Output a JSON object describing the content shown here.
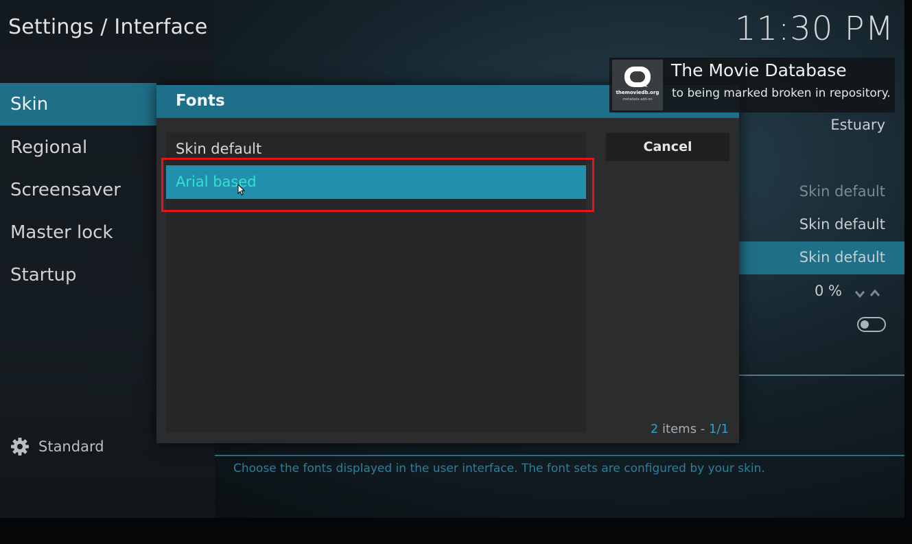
{
  "header": {
    "title": "Settings / Interface",
    "clock": "11:30 PM"
  },
  "sidebar": {
    "items": [
      {
        "label": "Skin"
      },
      {
        "label": "Regional"
      },
      {
        "label": "Screensaver"
      },
      {
        "label": "Master lock"
      },
      {
        "label": "Startup"
      }
    ],
    "active_index": 0,
    "settings_level": "Standard"
  },
  "background": {
    "values": {
      "skin": "Estuary",
      "value_1": "Skin default",
      "value_2": "Skin default",
      "value_3": "Skin default",
      "zoom": "0 %"
    },
    "description": "Choose the fonts displayed in the user interface. The font sets are configured by your skin."
  },
  "dialog": {
    "title": "Fonts",
    "items": [
      {
        "label": "Skin default"
      },
      {
        "label": "Arial based"
      }
    ],
    "selected_index": 1,
    "cancel_label": "Cancel",
    "count": {
      "items": "2",
      "items_word": "items -",
      "page": "1/1"
    }
  },
  "notification": {
    "title": "The Movie Database",
    "message": "to being marked broken in repository.",
    "logo_text": "themoviedb.org",
    "logo_sub": "metadata add-on"
  },
  "colors": {
    "accent": "#1f6f88",
    "selected_row": "#2290ac",
    "selected_text": "#33e0d2",
    "highlight_box": "#e0151d"
  }
}
